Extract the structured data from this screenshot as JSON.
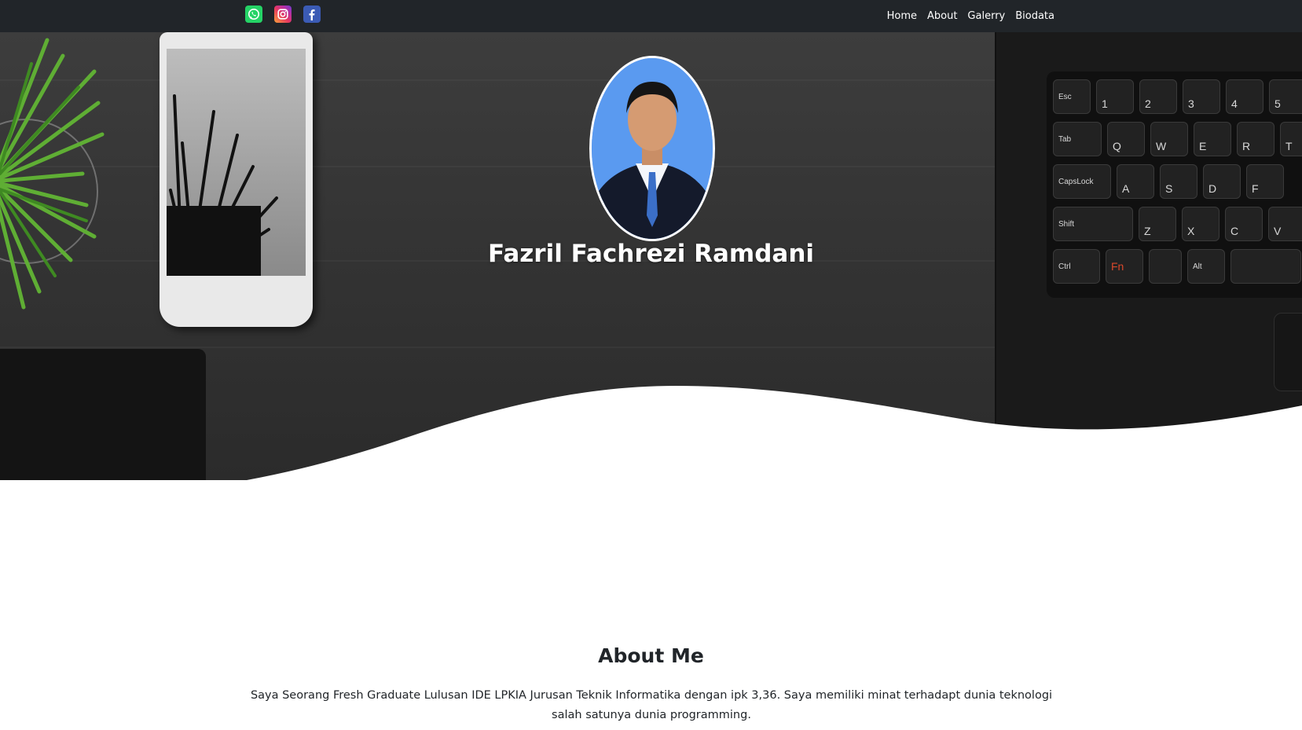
{
  "navbar": {
    "socials": [
      {
        "name": "WhatsApp",
        "icon": "whatsapp-icon",
        "color": "#25d366"
      },
      {
        "name": "Instagram",
        "icon": "instagram-icon",
        "color": "#e1306c"
      },
      {
        "name": "Facebook",
        "icon": "facebook-icon",
        "color": "#3b5bb5"
      }
    ],
    "links": [
      "Home",
      "About",
      "Galerry",
      "Biodata"
    ],
    "background": "#212529"
  },
  "hero": {
    "name": "Fazril Fachrezi Ramdani",
    "photo_background": "#4f8fe8"
  },
  "about": {
    "title": "About Me",
    "text": "Saya Seorang Fresh Graduate Lulusan IDE LPKIA Jurusan Teknik Informatika dengan ipk 3,36. Saya memiliki minat terhadapt dunia teknologi salah satunya dunia programming."
  }
}
